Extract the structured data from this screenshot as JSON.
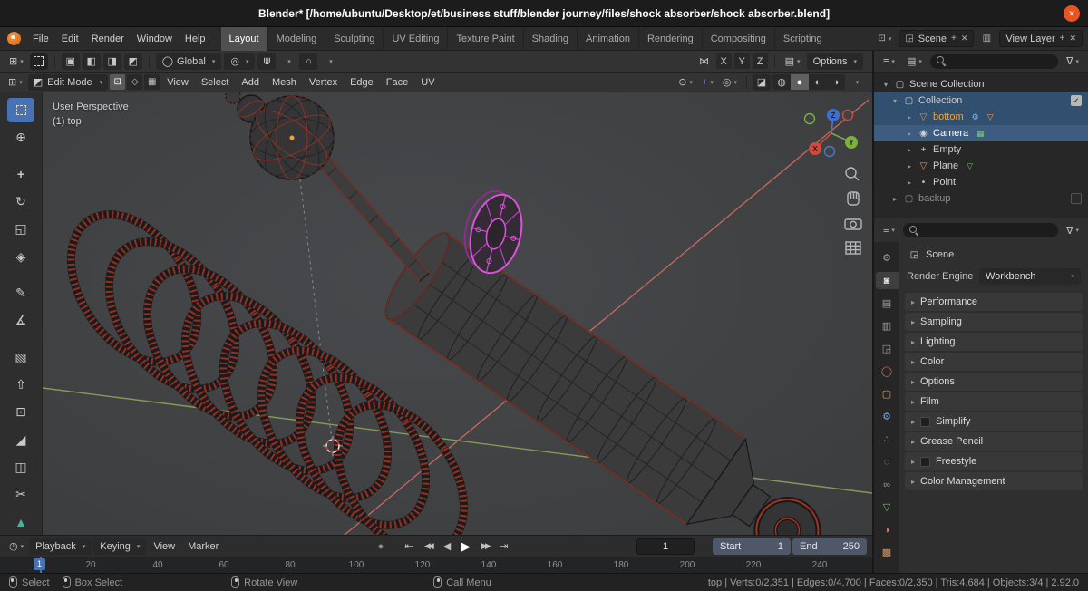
{
  "titlebar": {
    "title": "Blender* [/home/ubuntu/Desktop/et/business stuff/blender journey/files/shock absorber/shock absorber.blend]",
    "close": "✕"
  },
  "menubar": {
    "menus": [
      "File",
      "Edit",
      "Render",
      "Window",
      "Help"
    ]
  },
  "workspaces": {
    "tabs": [
      "Layout",
      "Modeling",
      "Sculpting",
      "UV Editing",
      "Texture Paint",
      "Shading",
      "Animation",
      "Rendering",
      "Compositing",
      "Scripting"
    ]
  },
  "scene_widgets": {
    "scene": "Scene",
    "view_layer": "View Layer"
  },
  "tool_settings": {
    "orientation": "Global",
    "mirror": [
      "X",
      "Y",
      "Z"
    ],
    "options": "Options"
  },
  "viewport_header": {
    "mode": "Edit Mode",
    "menus": [
      "View",
      "Select",
      "Add",
      "Mesh",
      "Vertex",
      "Edge",
      "Face",
      "UV"
    ]
  },
  "viewport": {
    "overlay_title": "User Perspective",
    "overlay_subtitle": "(1) top",
    "axes": {
      "x": "X",
      "y": "Y",
      "z": "Z"
    }
  },
  "outliner": {
    "rows": [
      {
        "label": "Scene Collection"
      },
      {
        "label": "Collection"
      },
      {
        "label": "bottom"
      },
      {
        "label": "Camera"
      },
      {
        "label": "Empty"
      },
      {
        "label": "Plane"
      },
      {
        "label": "Point"
      },
      {
        "label": "backup"
      }
    ]
  },
  "properties": {
    "breadcrumb": "Scene",
    "render_engine_label": "Render Engine",
    "render_engine_value": "Workbench",
    "panels": [
      {
        "label": "Performance"
      },
      {
        "label": "Sampling"
      },
      {
        "label": "Lighting"
      },
      {
        "label": "Color"
      },
      {
        "label": "Options"
      },
      {
        "label": "Film"
      },
      {
        "label": "Simplify"
      },
      {
        "label": "Grease Pencil"
      },
      {
        "label": "Freestyle"
      },
      {
        "label": "Color Management"
      }
    ]
  },
  "timeline": {
    "menus": [
      "Playback",
      "Keying",
      "View",
      "Marker"
    ],
    "current_frame": "1",
    "start_label": "Start",
    "start_value": "1",
    "end_label": "End",
    "end_value": "250",
    "ruler": [
      "20",
      "40",
      "60",
      "80",
      "100",
      "120",
      "140",
      "160",
      "180",
      "200",
      "220",
      "240"
    ]
  },
  "statusbar": {
    "hints": [
      "Select",
      "Box Select",
      "Rotate View",
      "Call Menu"
    ],
    "stats": "top | Verts:0/2,351 | Edges:0/4,700 | Faces:0/2,350 | Tris:4,684 | Objects:3/4 | 2.92.0"
  },
  "colors": {
    "accent_blue": "#4772b3",
    "selected_orange": "#eda33d",
    "close_button": "#e9541f",
    "axis_x": "#d04a3a",
    "axis_y": "#7bb03c",
    "axis_z": "#3f6fd0",
    "highlight_magenta": "#df52df",
    "wire_red": "#a5321f"
  }
}
